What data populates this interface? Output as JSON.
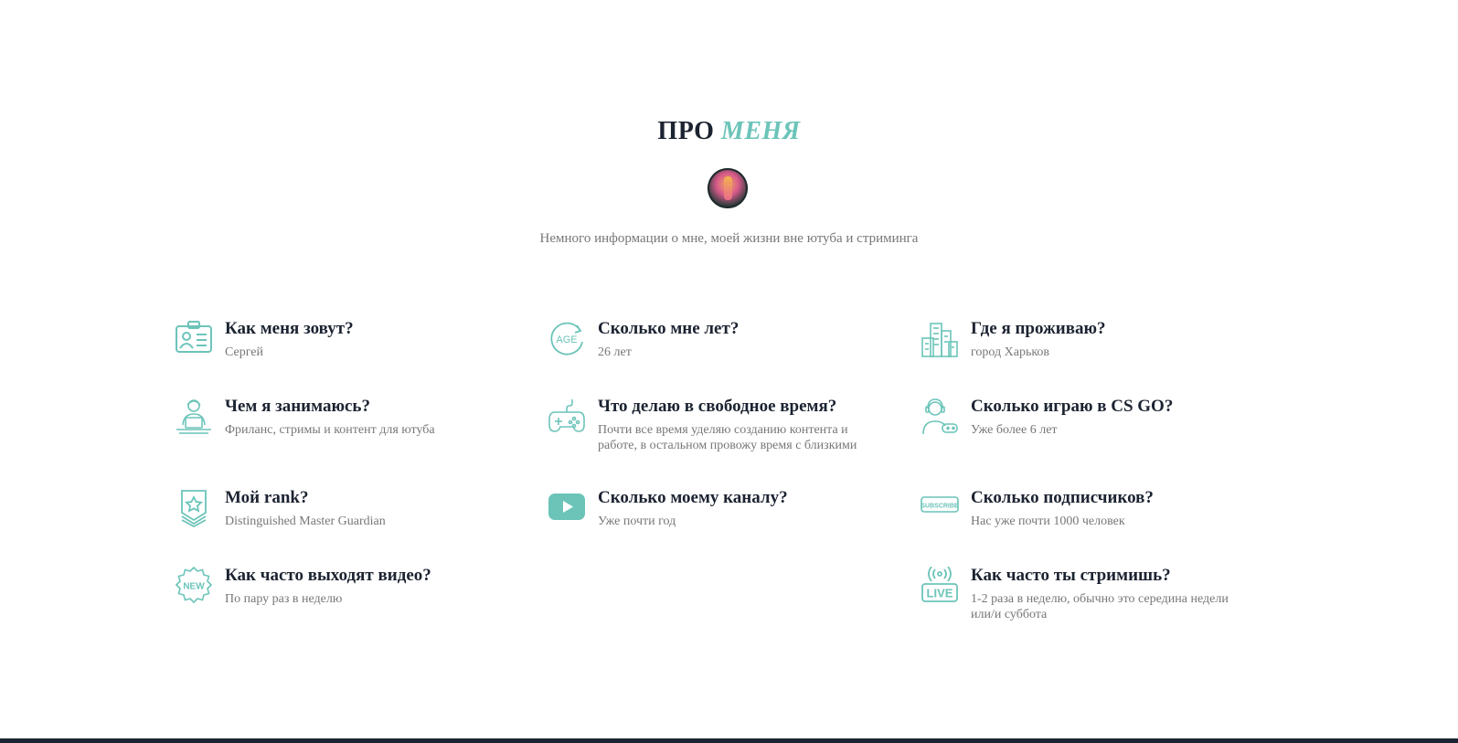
{
  "section": {
    "title_main": "ПРО",
    "title_accent": "МЕНЯ",
    "subtitle": "Немного информации о мне, моей жизни вне ютуба и стриминга"
  },
  "items": [
    {
      "icon": "id-card-icon",
      "question": "Как меня зовут?",
      "answer": "Сергей"
    },
    {
      "icon": "age-icon",
      "question": "Сколько мне лет?",
      "answer": "26 лет"
    },
    {
      "icon": "city-buildings-icon",
      "question": "Где я проживаю?",
      "answer": "город Харьков"
    },
    {
      "icon": "freelancer-laptop-icon",
      "question": "Чем я занимаюсь?",
      "answer": "Фриланс, стримы и контент для ютуба"
    },
    {
      "icon": "gamepad-icon",
      "question": "Что делаю в свободное время?",
      "answer": "Почти все время уделяю созданию контента и работе, в остальном провожу время с близкими"
    },
    {
      "icon": "gamer-headset-icon",
      "question": "Сколько играю в CS GO?",
      "answer": "Уже более 6 лет"
    },
    {
      "icon": "rank-badge-icon",
      "question": "Мой rank?",
      "answer": "Distinguished Master Guardian"
    },
    {
      "icon": "youtube-play-icon",
      "question": "Сколько моему каналу?",
      "answer": "Уже почти год"
    },
    {
      "icon": "subscribe-icon",
      "question": "Сколько подписчиков?",
      "answer": "Нас уже почти 1000 человек"
    },
    {
      "icon": "new-badge-icon",
      "question": "Как часто выходят видео?",
      "answer": "По пару раз в неделю"
    },
    {
      "icon": "live-stream-icon",
      "question": "Как часто ты стримишь?",
      "answer": "1-2 раза в неделю, обычно это середина недели или/и суббота"
    }
  ],
  "icon_labels": {
    "age": "AGE",
    "new": "NEW",
    "subscribe": "SUBSCRIBE",
    "live": "LIVE"
  },
  "colors": {
    "accent": "#6cc4b9",
    "heading": "#1c2331",
    "text": "#777777"
  }
}
